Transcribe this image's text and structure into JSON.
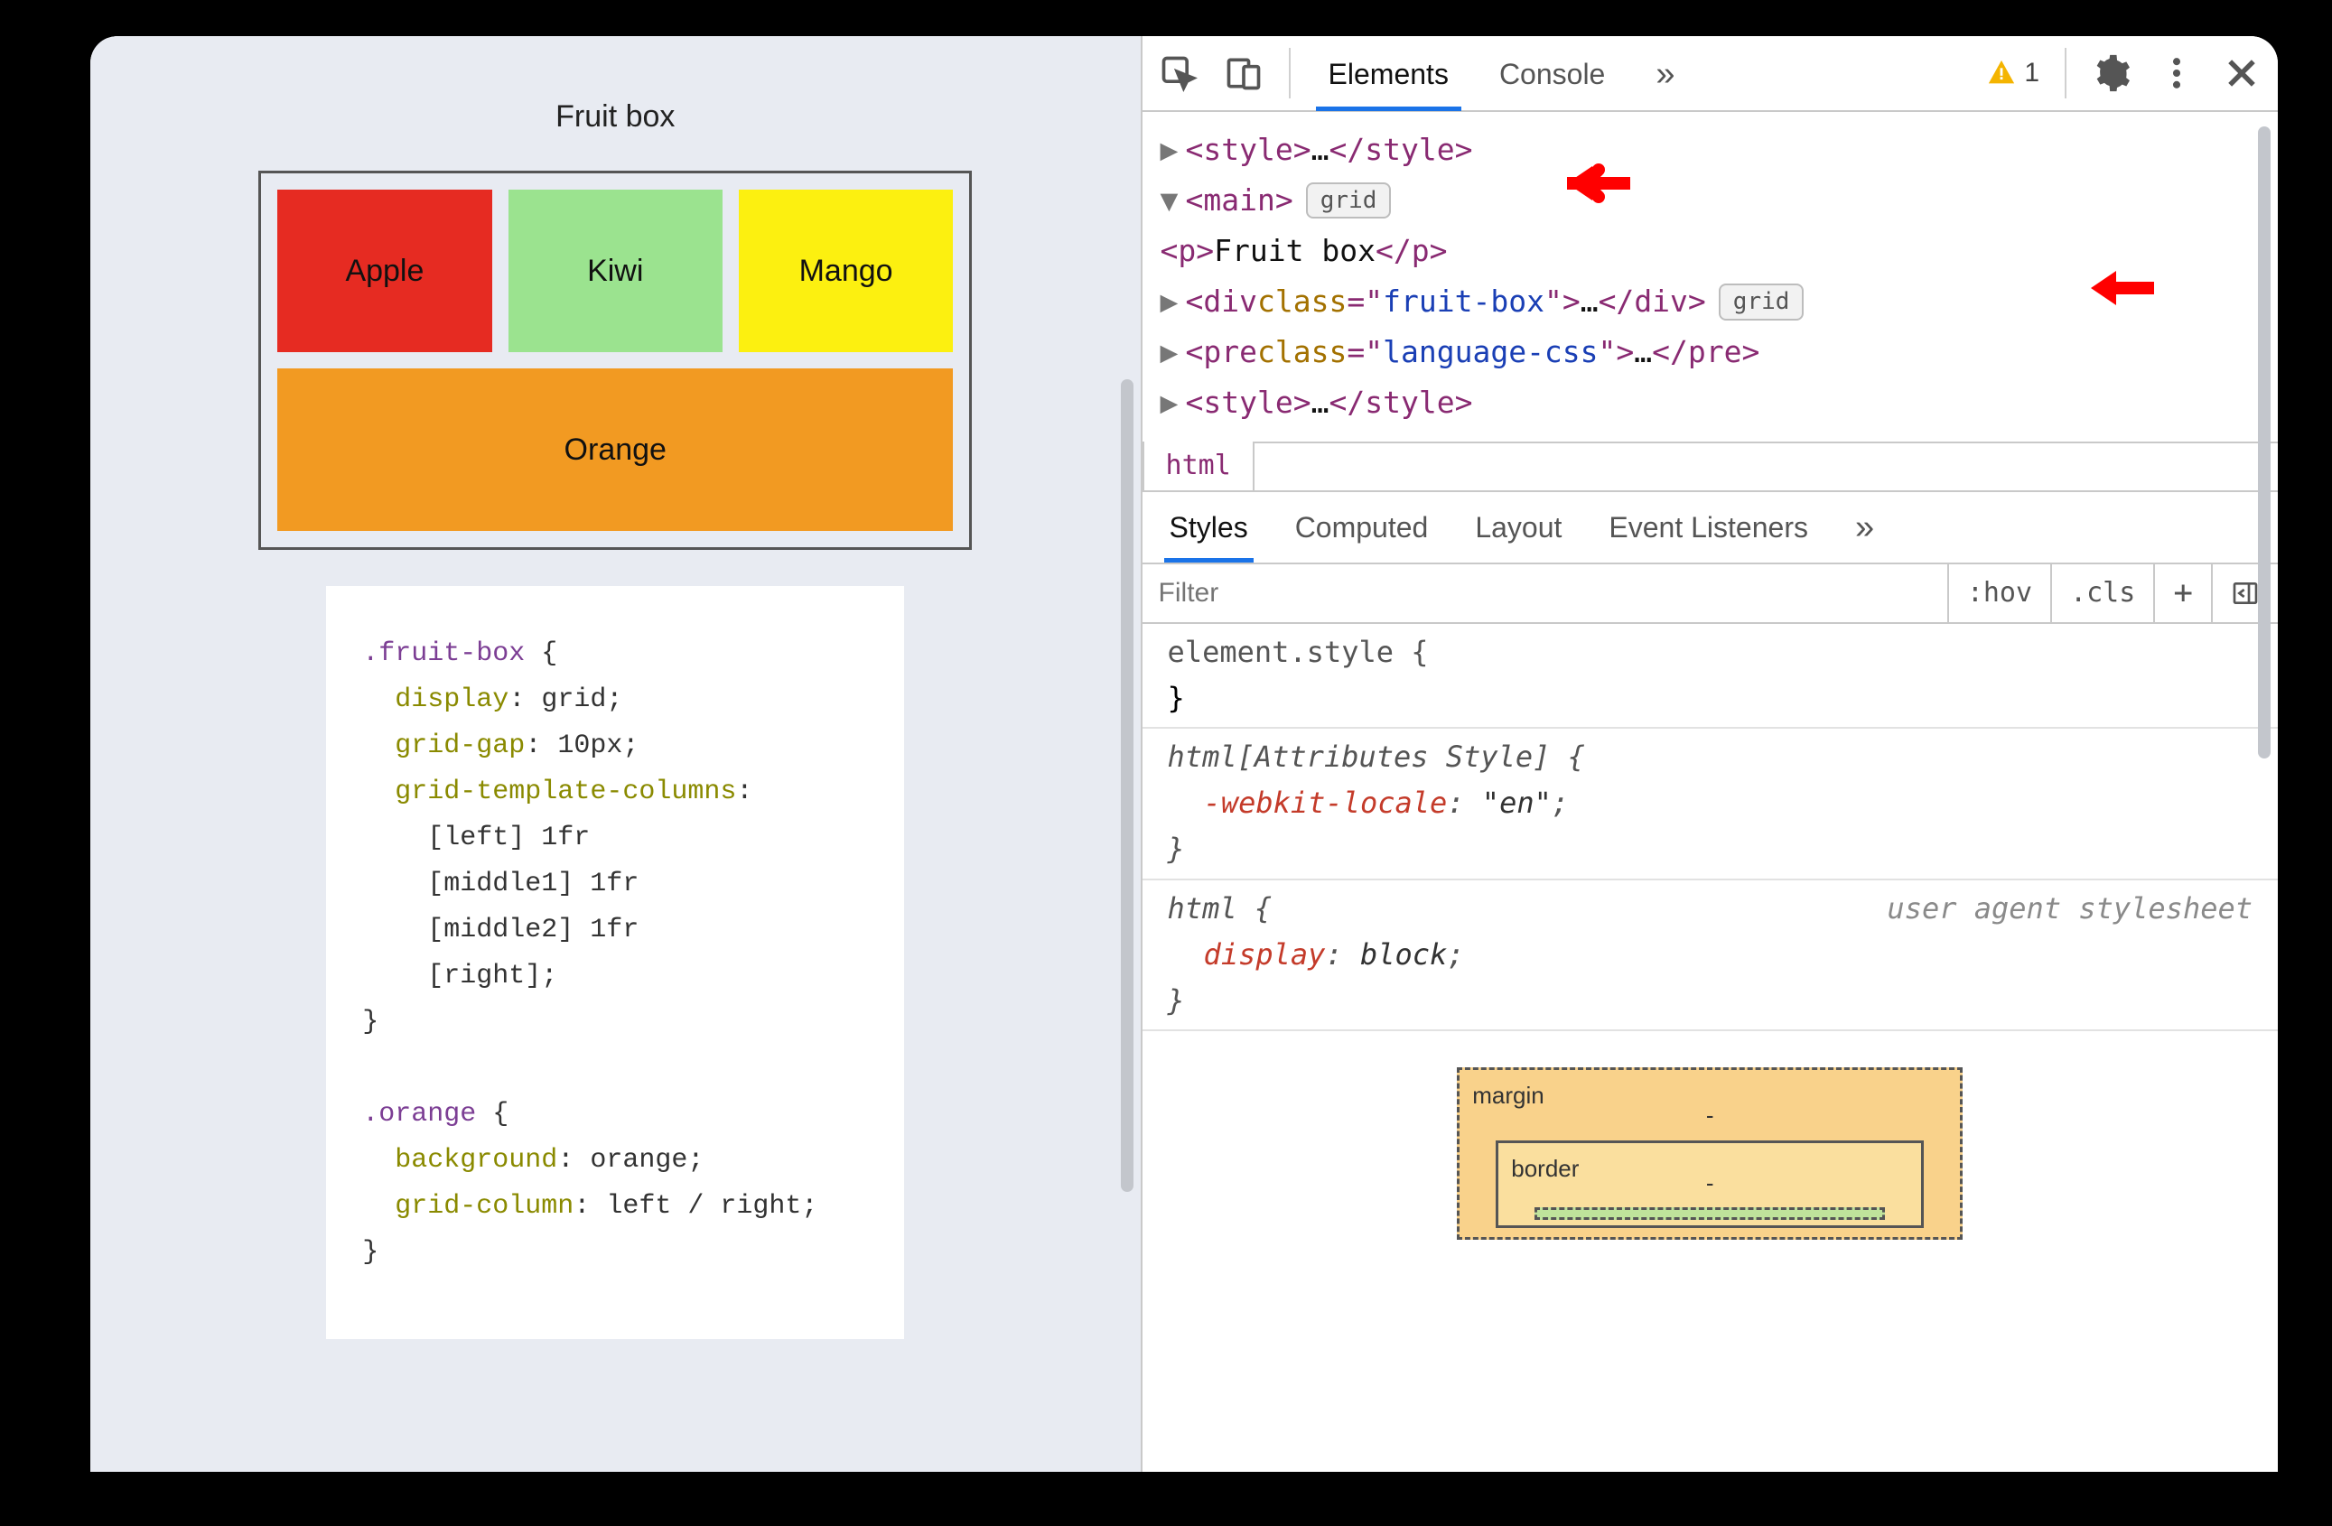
{
  "preview": {
    "title": "Fruit box",
    "fruits": {
      "apple": "Apple",
      "kiwi": "Kiwi",
      "mango": "Mango",
      "orange": "Orange"
    },
    "code_lines": [
      {
        "sel": ".fruit-box",
        "open": " {"
      },
      {
        "prop": "display",
        "val": "grid"
      },
      {
        "prop": "grid-gap",
        "val": "10px"
      },
      {
        "prop": "grid-template-columns",
        "val_after": ":"
      },
      {
        "plain": "[left] 1fr"
      },
      {
        "plain": "[middle1] 1fr"
      },
      {
        "plain": "[middle2] 1fr"
      },
      {
        "plain": "[right]",
        "semi": true
      },
      {
        "close": "}"
      },
      {
        "blank": true
      },
      {
        "sel": ".orange",
        "open": " {"
      },
      {
        "prop": "background",
        "val": "orange"
      },
      {
        "prop": "grid-column",
        "val": "left / right"
      },
      {
        "close": "}"
      }
    ]
  },
  "devtools": {
    "tabs": {
      "elements": "Elements",
      "console": "Console"
    },
    "more_glyph": "»",
    "warning_count": "1",
    "dom": {
      "row1": {
        "pre": "  ",
        "arrow": "▶",
        "open": "<",
        "tag": "style",
        "close": ">",
        "ell": "…",
        "open2": "</",
        "tag2": "style",
        "close2": ">"
      },
      "row2": {
        "pre": "  ",
        "arrow": "▼",
        "open": "<",
        "tag": "main",
        "close": ">",
        "badge": "grid"
      },
      "row3": {
        "pre": "     ",
        "open": "<",
        "tag": "p",
        "close": ">",
        "text": "Fruit box",
        "open2": "</",
        "tag2": "p",
        "close2": ">"
      },
      "row4": {
        "pre": "    ",
        "arrow": "▶",
        "open": "<",
        "tag": "div",
        "sp": " ",
        "attr": "class",
        "eq": "=\"",
        "attrv": "fruit-box",
        "eq2": "\"",
        "close": ">",
        "ell": "…",
        "open2": "</",
        "tag2": "div",
        "close2": ">",
        "badge": "grid"
      },
      "row5": {
        "pre": "    ",
        "arrow": "▶",
        "open": "<",
        "tag": "pre",
        "sp": " ",
        "attr": "class",
        "eq": "=\"",
        "attrv": "language-css",
        "eq2": "\"",
        "close": ">",
        "ell": "…",
        "open2": "</",
        "tag2": "pre",
        "close2": ">"
      },
      "row6": {
        "pre": "    ",
        "arrow": "▶",
        "open": "<",
        "tag": "style",
        "close": ">",
        "ell": "…",
        "open2": "</",
        "tag2": "style",
        "close2": ">"
      }
    },
    "breadcrumb": "html",
    "styles_tabs": {
      "styles": "Styles",
      "computed": "Computed",
      "layout": "Layout",
      "eventlisteners": "Event Listeners"
    },
    "filter_placeholder": "Filter",
    "filter_btns": {
      "hov": ":hov",
      "cls": ".cls",
      "plus": "+"
    },
    "rules": {
      "element_style": "element.style {",
      "element_style_close": "}",
      "attr_style_sel": "html[Attributes Style] {",
      "attr_style_prop": "-webkit-locale",
      "attr_style_val": "\"en\"",
      "attr_style_close": "}",
      "html_sel": "html {",
      "html_src": "user agent stylesheet",
      "html_prop": "display",
      "html_val": "block",
      "html_close": "}"
    },
    "box_model": {
      "margin": "margin",
      "border": "border",
      "dash": "-"
    }
  }
}
